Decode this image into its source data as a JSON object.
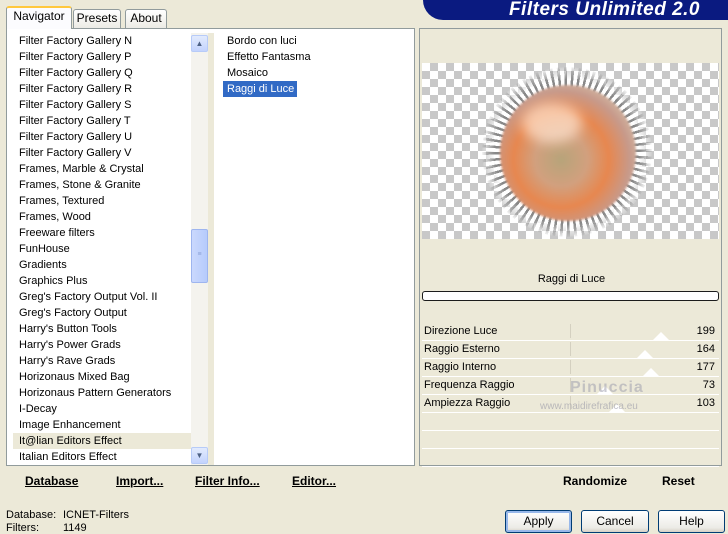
{
  "tabs": [
    {
      "label": "Navigator"
    },
    {
      "label": "Presets"
    },
    {
      "label": "About"
    }
  ],
  "header": {
    "title": "Filters Unlimited 2.0"
  },
  "categories": [
    "Filter Factory Gallery N",
    "Filter Factory Gallery P",
    "Filter Factory Gallery Q",
    "Filter Factory Gallery R",
    "Filter Factory Gallery S",
    "Filter Factory Gallery T",
    "Filter Factory Gallery U",
    "Filter Factory Gallery V",
    "Frames, Marble & Crystal",
    "Frames, Stone & Granite",
    "Frames, Textured",
    "Frames, Wood",
    "Freeware filters",
    "FunHouse",
    "Gradients",
    "Graphics Plus",
    "Greg's Factory Output Vol. II",
    "Greg's Factory Output",
    "Harry's Button Tools",
    "Harry's Power Grads",
    "Harry's Rave Grads",
    "Horizonaus Mixed Bag",
    "Horizonaus Pattern Generators",
    "I-Decay",
    "Image Enhancement",
    "It@lian Editors Effect",
    "Italian Editors Effect"
  ],
  "selected_category_index": 25,
  "filters": [
    "Bordo con luci",
    "Effetto Fantasma",
    "Mosaico",
    "Raggi di Luce"
  ],
  "selected_filter_index": 3,
  "left_actions": {
    "database": "Database",
    "import": "Import...",
    "filter_info": "Filter Info...",
    "editor": "Editor..."
  },
  "preview": {
    "filter_name": "Raggi di Luce"
  },
  "params": [
    {
      "label": "Direzione Luce",
      "value": "199",
      "level": 0.78
    },
    {
      "label": "Raggio Esterno",
      "value": "164",
      "level": 0.64
    },
    {
      "label": "Raggio Interno",
      "value": "177",
      "level": 0.69
    },
    {
      "label": "Frequenza Raggio",
      "value": "73",
      "level": 0.29
    },
    {
      "label": "Ampiezza Raggio",
      "value": "103",
      "level": 0.4
    }
  ],
  "watermark": {
    "name": "Pinuccia",
    "site": "www.maidirefrafica.eu"
  },
  "right_actions": {
    "randomize": "Randomize",
    "reset": "Reset"
  },
  "footer": {
    "database_label": "Database:",
    "database_value": "ICNET-Filters",
    "filters_label": "Filters:",
    "filters_value": "1149",
    "apply": "Apply",
    "cancel": "Cancel",
    "help": "Help"
  }
}
